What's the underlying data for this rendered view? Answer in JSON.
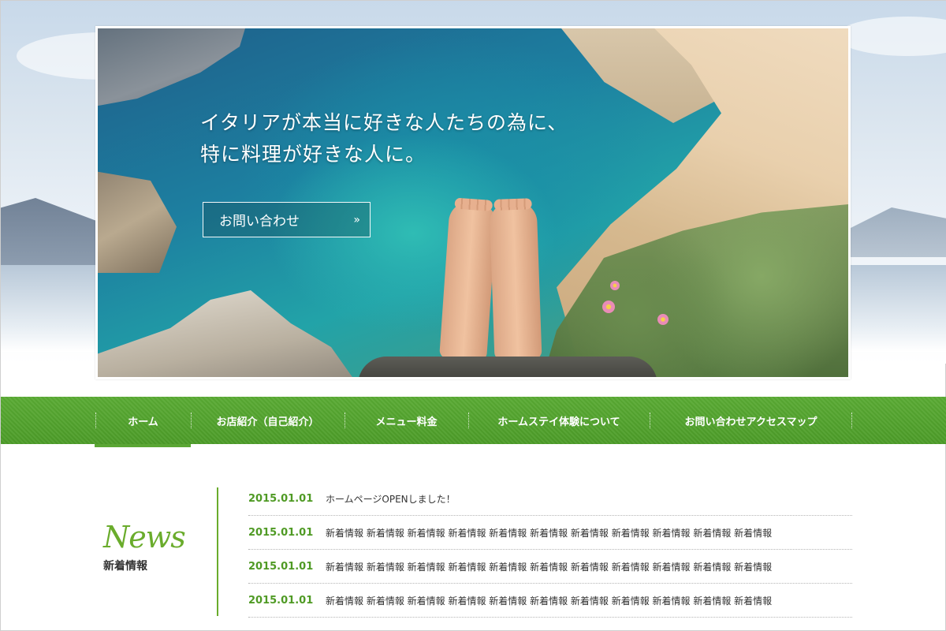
{
  "hero": {
    "headline_line1": "イタリアが本当に好きな人たちの為に、",
    "headline_line2": "特に料理が好きな人に。",
    "cta_label": "お問い合わせ",
    "cta_icon": "double-chevron-right-icon",
    "cta_chevron": "»"
  },
  "nav": {
    "items": [
      {
        "label": "ホーム",
        "active": true
      },
      {
        "label": "お店紹介（自己紹介）"
      },
      {
        "label": "メニュー料金"
      },
      {
        "label": "ホームステイ体験について"
      },
      {
        "label": "お問い合わせアクセスマップ"
      }
    ]
  },
  "news": {
    "script_title": "News",
    "title": "新着情報",
    "items": [
      {
        "date": "2015.01.01",
        "text": "ホームページOPENしました！"
      },
      {
        "date": "2015.01.01",
        "text": "新着情報 新着情報 新着情報 新着情報 新着情報 新着情報 新着情報 新着情報 新着情報 新着情報 新着情報"
      },
      {
        "date": "2015.01.01",
        "text": "新着情報 新着情報 新着情報 新着情報 新着情報 新着情報 新着情報 新着情報 新着情報 新着情報 新着情報"
      },
      {
        "date": "2015.01.01",
        "text": "新着情報 新着情報 新着情報 新着情報 新着情報 新着情報 新着情報 新着情報 新着情報 新着情報 新着情報"
      }
    ]
  },
  "colors": {
    "brand_green": "#5aab34",
    "date_green": "#4f9a24",
    "text_dark": "#333333"
  }
}
